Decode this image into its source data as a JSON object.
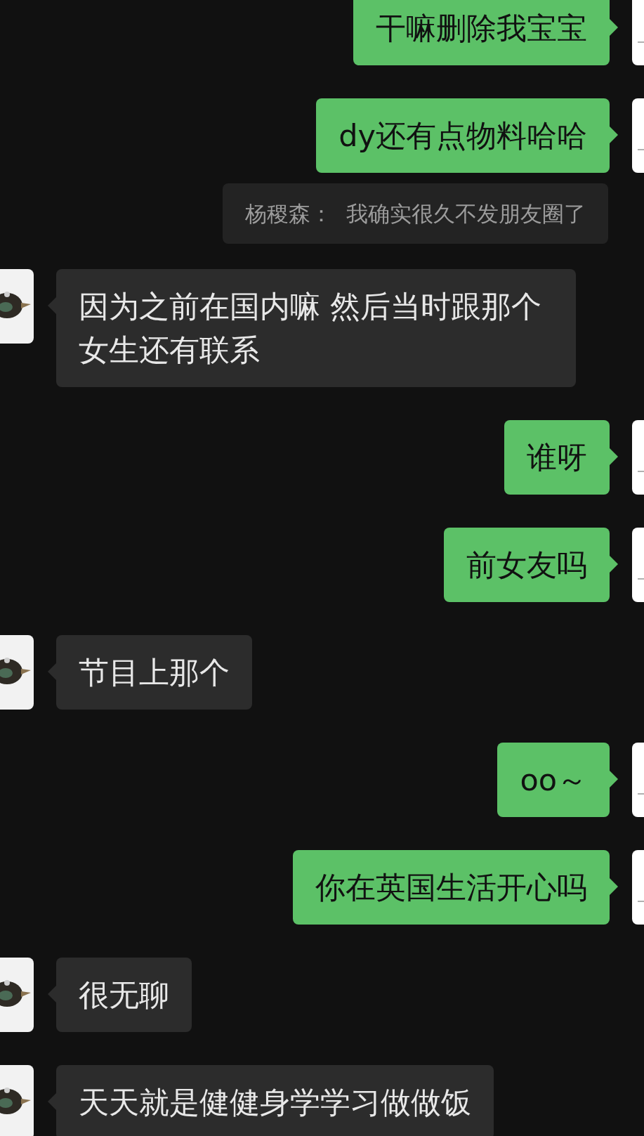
{
  "messages": [
    {
      "kind": "out",
      "text": "干嘛删除我宝宝"
    },
    {
      "kind": "out",
      "text": "dy还有点物料哈哈"
    },
    {
      "kind": "quote",
      "text": "杨稷森：  我确实很久不发朋友圈了"
    },
    {
      "kind": "in",
      "text": "因为之前在国内嘛 然后当时跟那个女生还有联系"
    },
    {
      "kind": "out",
      "text": "谁呀"
    },
    {
      "kind": "out",
      "text": "前女友吗"
    },
    {
      "kind": "in",
      "text": "节目上那个"
    },
    {
      "kind": "out",
      "text": "oo～"
    },
    {
      "kind": "out",
      "text": "你在英国生活开心吗"
    },
    {
      "kind": "in",
      "text": "很无聊"
    },
    {
      "kind": "in",
      "text": "天天就是健健身学学习做做饭"
    }
  ]
}
